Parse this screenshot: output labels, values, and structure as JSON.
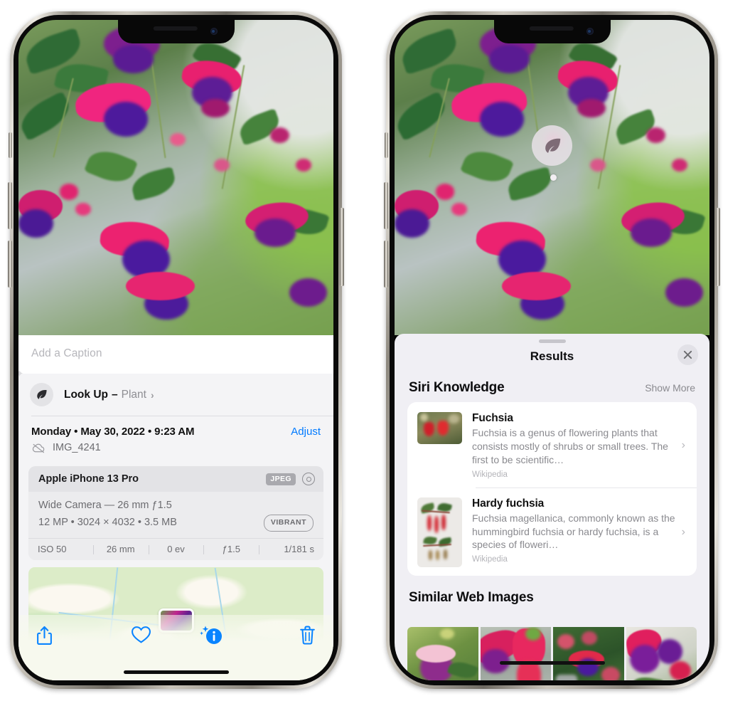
{
  "left_phone": {
    "photo": {
      "alt": "fuchsia-flowers-photo"
    },
    "caption": {
      "placeholder": "Add a Caption",
      "value": ""
    },
    "lookup": {
      "label": "Look Up",
      "dash": "–",
      "subject": "Plant",
      "chevron": "›",
      "icon": "leaf-icon"
    },
    "metadata": {
      "date": "Monday • May 30, 2022 • 9:23 AM",
      "adjust_label": "Adjust",
      "filename": "IMG_4241",
      "cloud_icon": "cloud-slash-icon"
    },
    "camera_card": {
      "device": "Apple iPhone 13 Pro",
      "format_badge": "JPEG",
      "raw_icon": "raw-circle-icon",
      "lens_line": "Wide Camera — 26 mm ƒ1.5",
      "file_line": "12 MP • 3024 × 4032 • 3.5 MB",
      "style_badge": "VIBRANT",
      "exif": [
        "ISO 50",
        "26 mm",
        "0 ev",
        "ƒ1.5",
        "1/181 s"
      ]
    },
    "map": {
      "pin": "photo-pin"
    },
    "toolbar": [
      {
        "name": "share-button",
        "icon": "share-icon"
      },
      {
        "name": "favorite-button",
        "icon": "heart-icon"
      },
      {
        "name": "info-button",
        "icon": "info-sparkle-icon"
      },
      {
        "name": "delete-button",
        "icon": "trash-icon"
      }
    ],
    "accent_color": "#007aff"
  },
  "right_phone": {
    "visual_lookup_badge": {
      "icon": "leaf-icon"
    },
    "sheet": {
      "title": "Results",
      "close_icon": "close-icon",
      "sections": [
        {
          "title": "Siri Knowledge",
          "action": "Show More",
          "items": [
            {
              "title": "Fuchsia",
              "description": "Fuchsia is a genus of flowering plants that consists mostly of shrubs or small trees. The first to be scientific…",
              "source": "Wikipedia",
              "thumb": "fuchsia-red-flowers-thumb"
            },
            {
              "title": "Hardy fuchsia",
              "description": "Fuchsia magellanica, commonly known as the hummingbird fuchsia or hardy fuchsia, is a species of floweri…",
              "source": "Wikipedia",
              "thumb": "hardy-fuchsia-specimen-thumb"
            }
          ]
        },
        {
          "title": "Similar Web Images",
          "items": [
            {
              "thumb": "similar-image-1"
            },
            {
              "thumb": "similar-image-2"
            },
            {
              "thumb": "similar-image-3"
            },
            {
              "thumb": "similar-image-4"
            }
          ]
        }
      ]
    }
  }
}
